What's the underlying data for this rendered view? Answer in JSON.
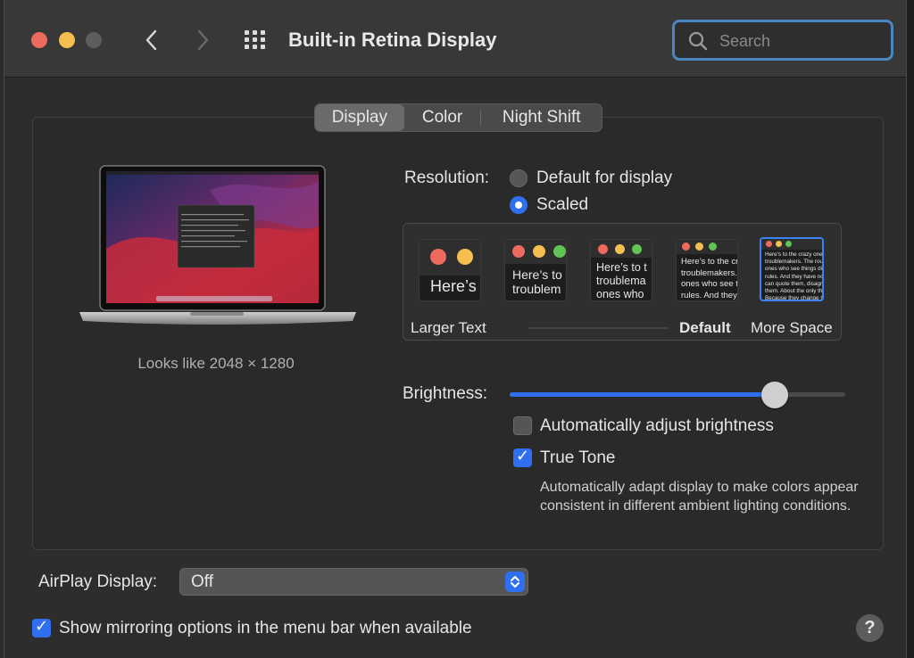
{
  "window": {
    "title": "Built-in Retina Display"
  },
  "search": {
    "placeholder": "Search"
  },
  "tabs": [
    {
      "label": "Display",
      "active": true
    },
    {
      "label": "Color",
      "active": false
    },
    {
      "label": "Night Shift",
      "active": false
    }
  ],
  "display_info": {
    "looks_like": "Looks like 2048 × 1280"
  },
  "resolution": {
    "label": "Resolution:",
    "options": [
      {
        "label": "Default for display",
        "selected": false
      },
      {
        "label": "Scaled",
        "selected": true
      }
    ],
    "scale_labels": {
      "larger": "Larger Text",
      "default": "Default",
      "more": "More Space"
    },
    "previews": [
      {
        "text": "Here’s"
      },
      {
        "text": "Here’s to t\ntroublem"
      },
      {
        "text": "Here’s to t\ntroublema\nones who"
      },
      {
        "text": "Here’s to the cr\ntroublemakers.\nones who see t\nrules. And they"
      },
      {
        "text": "Here’s to the crazy one\ntroublemakers. The rou\nones who see things di\nrules. And they have no\ncan quote them, disagr\nthem. About the only th\nBecause they change th"
      }
    ],
    "selected_index": 4
  },
  "brightness": {
    "label": "Brightness:",
    "level_percent": 79
  },
  "auto_brightness": {
    "label": "Automatically adjust brightness",
    "checked": false
  },
  "true_tone": {
    "label": "True Tone",
    "checked": true,
    "description": "Automatically adapt display to make colors appear consistent in different ambient lighting conditions."
  },
  "airplay": {
    "label": "AirPlay Display:",
    "value": "Off"
  },
  "mirroring": {
    "label": "Show mirroring options in the menu bar when available",
    "checked": true
  },
  "help": {
    "label": "?"
  },
  "colors": {
    "accent": "#2f6ff0",
    "close": "#ed6a5e",
    "minimize": "#f5bf4f",
    "zoom": "#5d5d5d",
    "focus_ring": "#4a86c0"
  }
}
